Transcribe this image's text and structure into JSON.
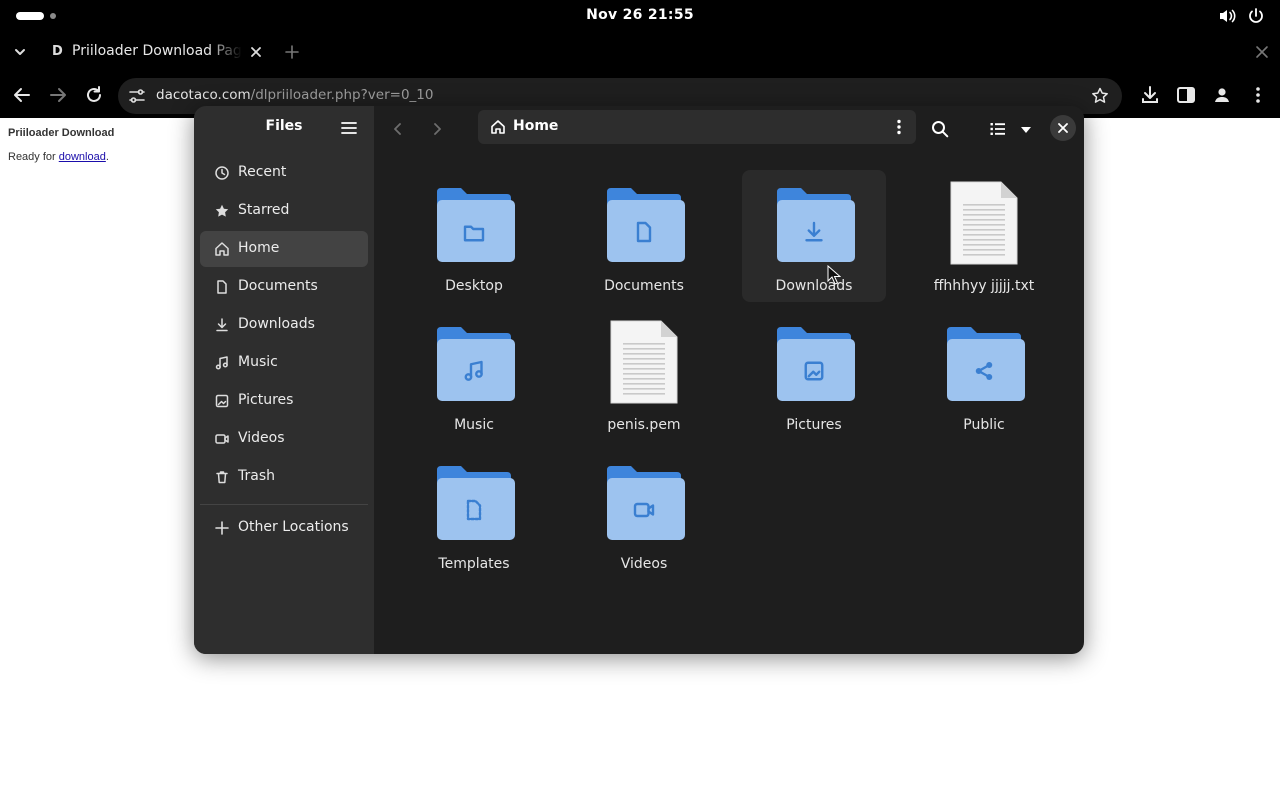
{
  "system_bar": {
    "clock": "Nov 26  21:55"
  },
  "browser": {
    "tab_title": "Priiloader Download Page",
    "tab_favicon": "D",
    "url_host": "dacotaco.com",
    "url_path": "/dlpriiloader.php?ver=0_10"
  },
  "webpage": {
    "heading": "Priiloader Download",
    "ready_prefix": "Ready for ",
    "download_link": "download",
    "ready_suffix": "."
  },
  "files": {
    "app_title": "Files",
    "path_label": "Home",
    "sidebar": {
      "items": [
        {
          "label": "Recent",
          "icon": "clock-icon"
        },
        {
          "label": "Starred",
          "icon": "star-icon"
        },
        {
          "label": "Home",
          "icon": "home-icon",
          "active": true
        },
        {
          "label": "Documents",
          "icon": "document-icon"
        },
        {
          "label": "Downloads",
          "icon": "download-icon"
        },
        {
          "label": "Music",
          "icon": "music-icon"
        },
        {
          "label": "Pictures",
          "icon": "image-icon"
        },
        {
          "label": "Videos",
          "icon": "video-icon"
        },
        {
          "label": "Trash",
          "icon": "trash-icon"
        }
      ],
      "other_locations": "Other Locations"
    },
    "grid": [
      {
        "name": "Desktop",
        "kind": "folder",
        "emblem": "folder-icon"
      },
      {
        "name": "Documents",
        "kind": "folder",
        "emblem": "document-icon"
      },
      {
        "name": "Downloads",
        "kind": "folder",
        "emblem": "download-icon"
      },
      {
        "name": "ffhhhyy jjjjj.txt",
        "kind": "text-file"
      },
      {
        "name": "Music",
        "kind": "folder",
        "emblem": "music-icon"
      },
      {
        "name": "penis.pem",
        "kind": "text-file"
      },
      {
        "name": "Pictures",
        "kind": "folder",
        "emblem": "image-icon"
      },
      {
        "name": "Public",
        "kind": "folder",
        "emblem": "share-icon"
      },
      {
        "name": "Templates",
        "kind": "folder",
        "emblem": "template-icon"
      },
      {
        "name": "Videos",
        "kind": "folder",
        "emblem": "video-icon"
      }
    ]
  },
  "colors": {
    "folder_front": "#9dc3ef",
    "folder_back": "#3e85dc",
    "folder_emblem": "#3a7fd1",
    "window_bg": "#1e1e1e",
    "sidebar_bg": "#2e2e2e",
    "active_row": "#434343"
  }
}
